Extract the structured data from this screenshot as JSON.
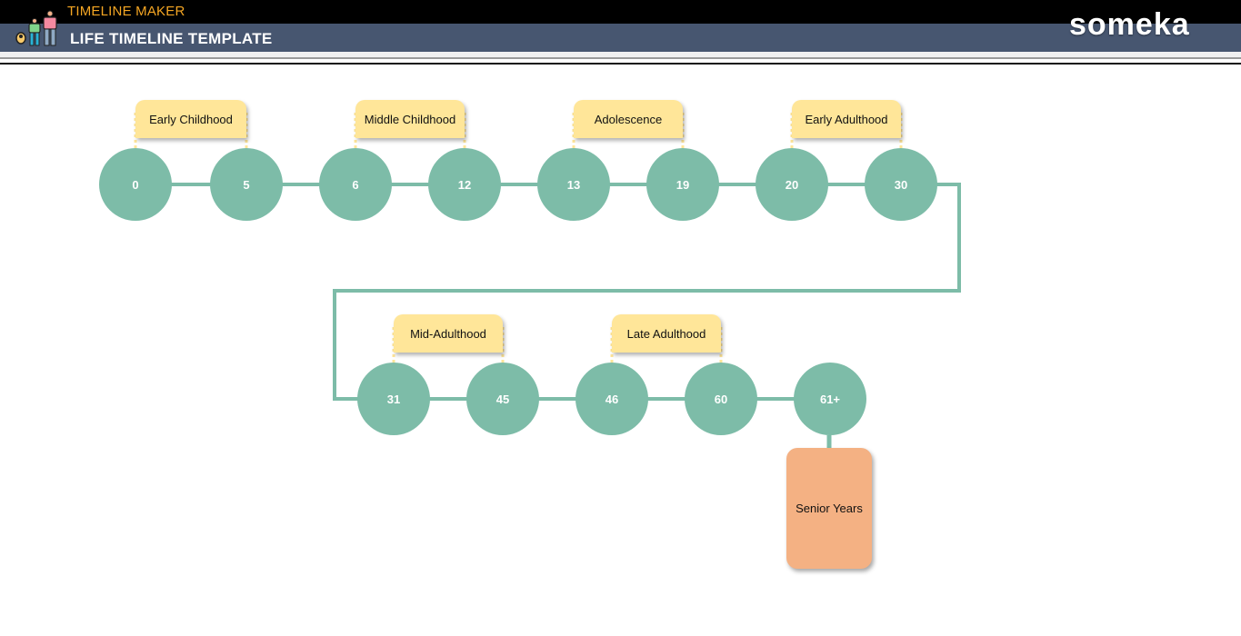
{
  "header": {
    "app_name": "TIMELINE MAKER",
    "page_title": "LIFE TIMELINE TEMPLATE",
    "brand": "someka",
    "logo_icon": "family-icon"
  },
  "colors": {
    "node": "#7dbca8",
    "connector": "#7dbca8",
    "label": "#ffe699",
    "final": "#f4b183",
    "header_bg": "#475670",
    "app_name": "#f5a623"
  },
  "timeline": {
    "rows": [
      {
        "nodes": [
          "0",
          "5",
          "6",
          "12",
          "13",
          "19",
          "20",
          "30"
        ],
        "stages": [
          {
            "label": "Early Childhood",
            "from": 0,
            "to": 1
          },
          {
            "label": "Middle Childhood",
            "from": 2,
            "to": 3
          },
          {
            "label": "Adolescence",
            "from": 4,
            "to": 5
          },
          {
            "label": "Early Adulthood",
            "from": 6,
            "to": 7
          }
        ]
      },
      {
        "nodes": [
          "31",
          "45",
          "46",
          "60",
          "61+"
        ],
        "stages": [
          {
            "label": "Mid-Adulthood",
            "from": 0,
            "to": 1
          },
          {
            "label": "Late Adulthood",
            "from": 2,
            "to": 3
          }
        ]
      }
    ],
    "final_stage": "Senior Years"
  }
}
